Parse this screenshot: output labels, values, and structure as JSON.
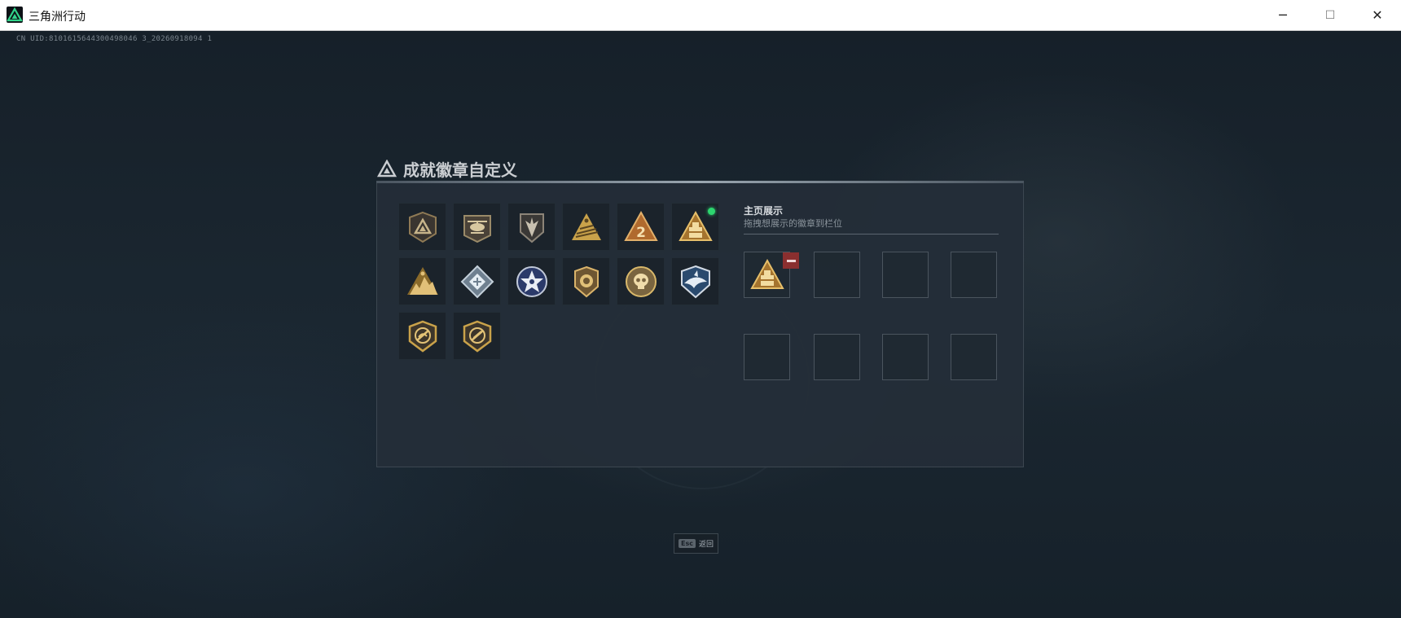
{
  "window": {
    "title": "三角洲行动",
    "minimize_glyph": "─",
    "maximize_glyph": "☐",
    "close_glyph": "✕"
  },
  "uid_text": "CN UID:8101615644300498046 3_20260918094 1",
  "dialog": {
    "title": "成就徽章自定义",
    "badges": [
      {
        "icon": "triangle-shield-badge-icon"
      },
      {
        "icon": "helicopter-badge-icon"
      },
      {
        "icon": "arrow-shield-badge-icon"
      },
      {
        "icon": "pyramid-stripes-badge-icon"
      },
      {
        "icon": "triangle-2-badge-icon"
      },
      {
        "icon": "triangle-block-badge-icon",
        "is_new": true
      },
      {
        "icon": "mountain-badge-icon"
      },
      {
        "icon": "diamond-badge-icon"
      },
      {
        "icon": "star-wreath-badge-icon"
      },
      {
        "icon": "coin-shield-badge-icon"
      },
      {
        "icon": "skull-badge-icon"
      },
      {
        "icon": "shark-badge-icon"
      },
      {
        "icon": "dino-shield-badge-icon"
      },
      {
        "icon": "rifle-shield-badge-icon"
      }
    ],
    "showcase": {
      "title": "主页展示",
      "hint": "拖拽想展示的徽章到栏位",
      "slots": [
        {
          "icon": "triangle-block-badge-icon",
          "filled": true
        },
        {
          "filled": false
        },
        {
          "filled": false
        },
        {
          "filled": false
        },
        {
          "filled": false
        },
        {
          "filled": false
        },
        {
          "filled": false
        },
        {
          "filled": false
        }
      ]
    }
  },
  "esc_hint": {
    "key": "Esc",
    "label": "返回"
  },
  "colors": {
    "accent_green": "#2dd66f",
    "remove_red": "#8a2f2f",
    "badge_gold": "#c9a24a"
  }
}
